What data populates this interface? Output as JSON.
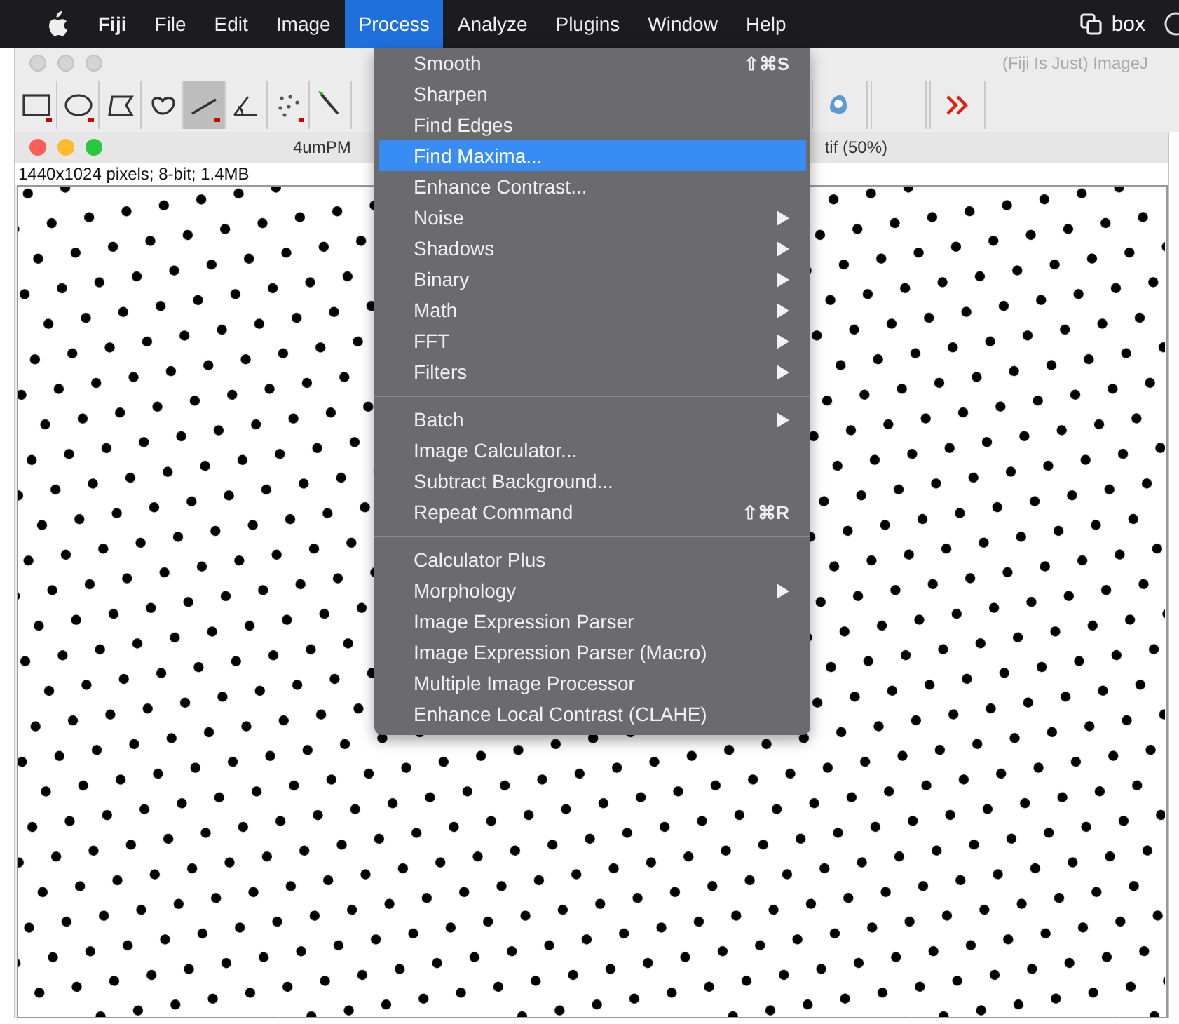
{
  "menu_bar": {
    "items": [
      {
        "label": "Fiji",
        "selected": false
      },
      {
        "label": "File",
        "selected": false
      },
      {
        "label": "Edit",
        "selected": false
      },
      {
        "label": "Image",
        "selected": false
      },
      {
        "label": "Process",
        "selected": true
      },
      {
        "label": "Analyze",
        "selected": false
      },
      {
        "label": "Plugins",
        "selected": false
      },
      {
        "label": "Window",
        "selected": false
      },
      {
        "label": "Help",
        "selected": false
      }
    ],
    "status_item": "box"
  },
  "main_window": {
    "title": "(Fiji Is Just) ImageJ",
    "tools": [
      {
        "selected": false
      },
      {
        "selected": false
      },
      {
        "selected": false
      },
      {
        "selected": false
      },
      {
        "selected": true
      },
      {
        "selected": false
      },
      {
        "selected": false
      },
      {
        "selected": false
      }
    ],
    "right_tools": [
      {
        "selected": false
      },
      {
        "selected": false
      },
      {
        "selected": false
      }
    ]
  },
  "image_window": {
    "title_left": "4umPM",
    "title_right": "tif (50%)",
    "info": "1440x1024 pixels; 8-bit; 1.4MB"
  },
  "process_menu": {
    "items": [
      {
        "kind": "item",
        "label": "Smooth",
        "shortcut": "⇧⌘S",
        "submenu": false,
        "selected": false
      },
      {
        "kind": "item",
        "label": "Sharpen",
        "submenu": false,
        "selected": false
      },
      {
        "kind": "item",
        "label": "Find Edges",
        "submenu": false,
        "selected": false
      },
      {
        "kind": "item",
        "label": "Find Maxima...",
        "submenu": false,
        "selected": true
      },
      {
        "kind": "item",
        "label": "Enhance Contrast...",
        "submenu": false,
        "selected": false
      },
      {
        "kind": "item",
        "label": "Noise",
        "submenu": true,
        "selected": false
      },
      {
        "kind": "item",
        "label": "Shadows",
        "submenu": true,
        "selected": false
      },
      {
        "kind": "item",
        "label": "Binary",
        "submenu": true,
        "selected": false
      },
      {
        "kind": "item",
        "label": "Math",
        "submenu": true,
        "selected": false
      },
      {
        "kind": "item",
        "label": "FFT",
        "submenu": true,
        "selected": false
      },
      {
        "kind": "item",
        "label": "Filters",
        "submenu": true,
        "selected": false
      },
      {
        "kind": "separator"
      },
      {
        "kind": "item",
        "label": "Batch",
        "submenu": true,
        "selected": false
      },
      {
        "kind": "item",
        "label": "Image Calculator...",
        "submenu": false,
        "selected": false
      },
      {
        "kind": "item",
        "label": "Subtract Background...",
        "submenu": false,
        "selected": false
      },
      {
        "kind": "item",
        "label": "Repeat Command",
        "shortcut": "⇧⌘R",
        "submenu": false,
        "selected": false
      },
      {
        "kind": "separator"
      },
      {
        "kind": "item",
        "label": "Calculator Plus",
        "submenu": false,
        "selected": false
      },
      {
        "kind": "item",
        "label": "Morphology",
        "submenu": true,
        "selected": false
      },
      {
        "kind": "item",
        "label": "Image Expression Parser",
        "submenu": false,
        "selected": false
      },
      {
        "kind": "item",
        "label": "Image Expression Parser (Macro)",
        "submenu": false,
        "selected": false
      },
      {
        "kind": "item",
        "label": "Multiple Image Processor",
        "submenu": false,
        "selected": false
      },
      {
        "kind": "item",
        "label": "Enhance Local Contrast (CLAHE)",
        "submenu": false,
        "selected": false
      }
    ]
  }
}
